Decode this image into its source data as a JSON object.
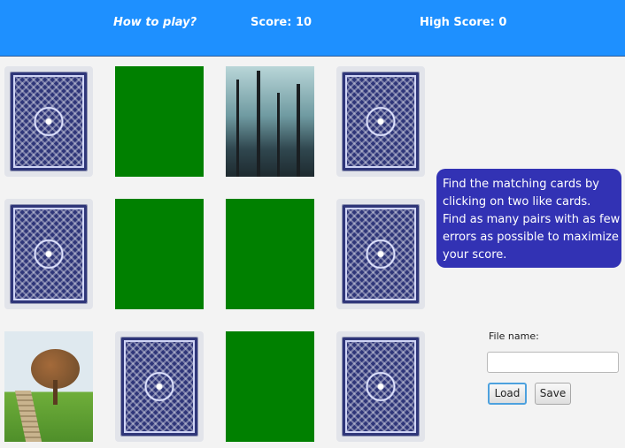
{
  "header": {
    "how_to_play": "How to play?",
    "score": "Score: 10",
    "high_score": "High Score: 0"
  },
  "colors": {
    "header_bg": "#1e90ff",
    "matched_card": "#008000",
    "info_bg": "#3232b4",
    "card_back": "#2f3679"
  },
  "board": {
    "rows": [
      [
        "back",
        "matched",
        "image-forest",
        "back"
      ],
      [
        "back",
        "matched",
        "matched",
        "back"
      ],
      [
        "image-hill-tree",
        "back",
        "matched",
        "back"
      ]
    ]
  },
  "info": {
    "lines": [
      "Find the matching cards by",
      " clicking on two like cards.",
      " Find as many pairs with as few",
      " errors as possible to maximize",
      " your score."
    ]
  },
  "file": {
    "label": "File name:",
    "value": "",
    "load_label": "Load",
    "save_label": "Save"
  }
}
